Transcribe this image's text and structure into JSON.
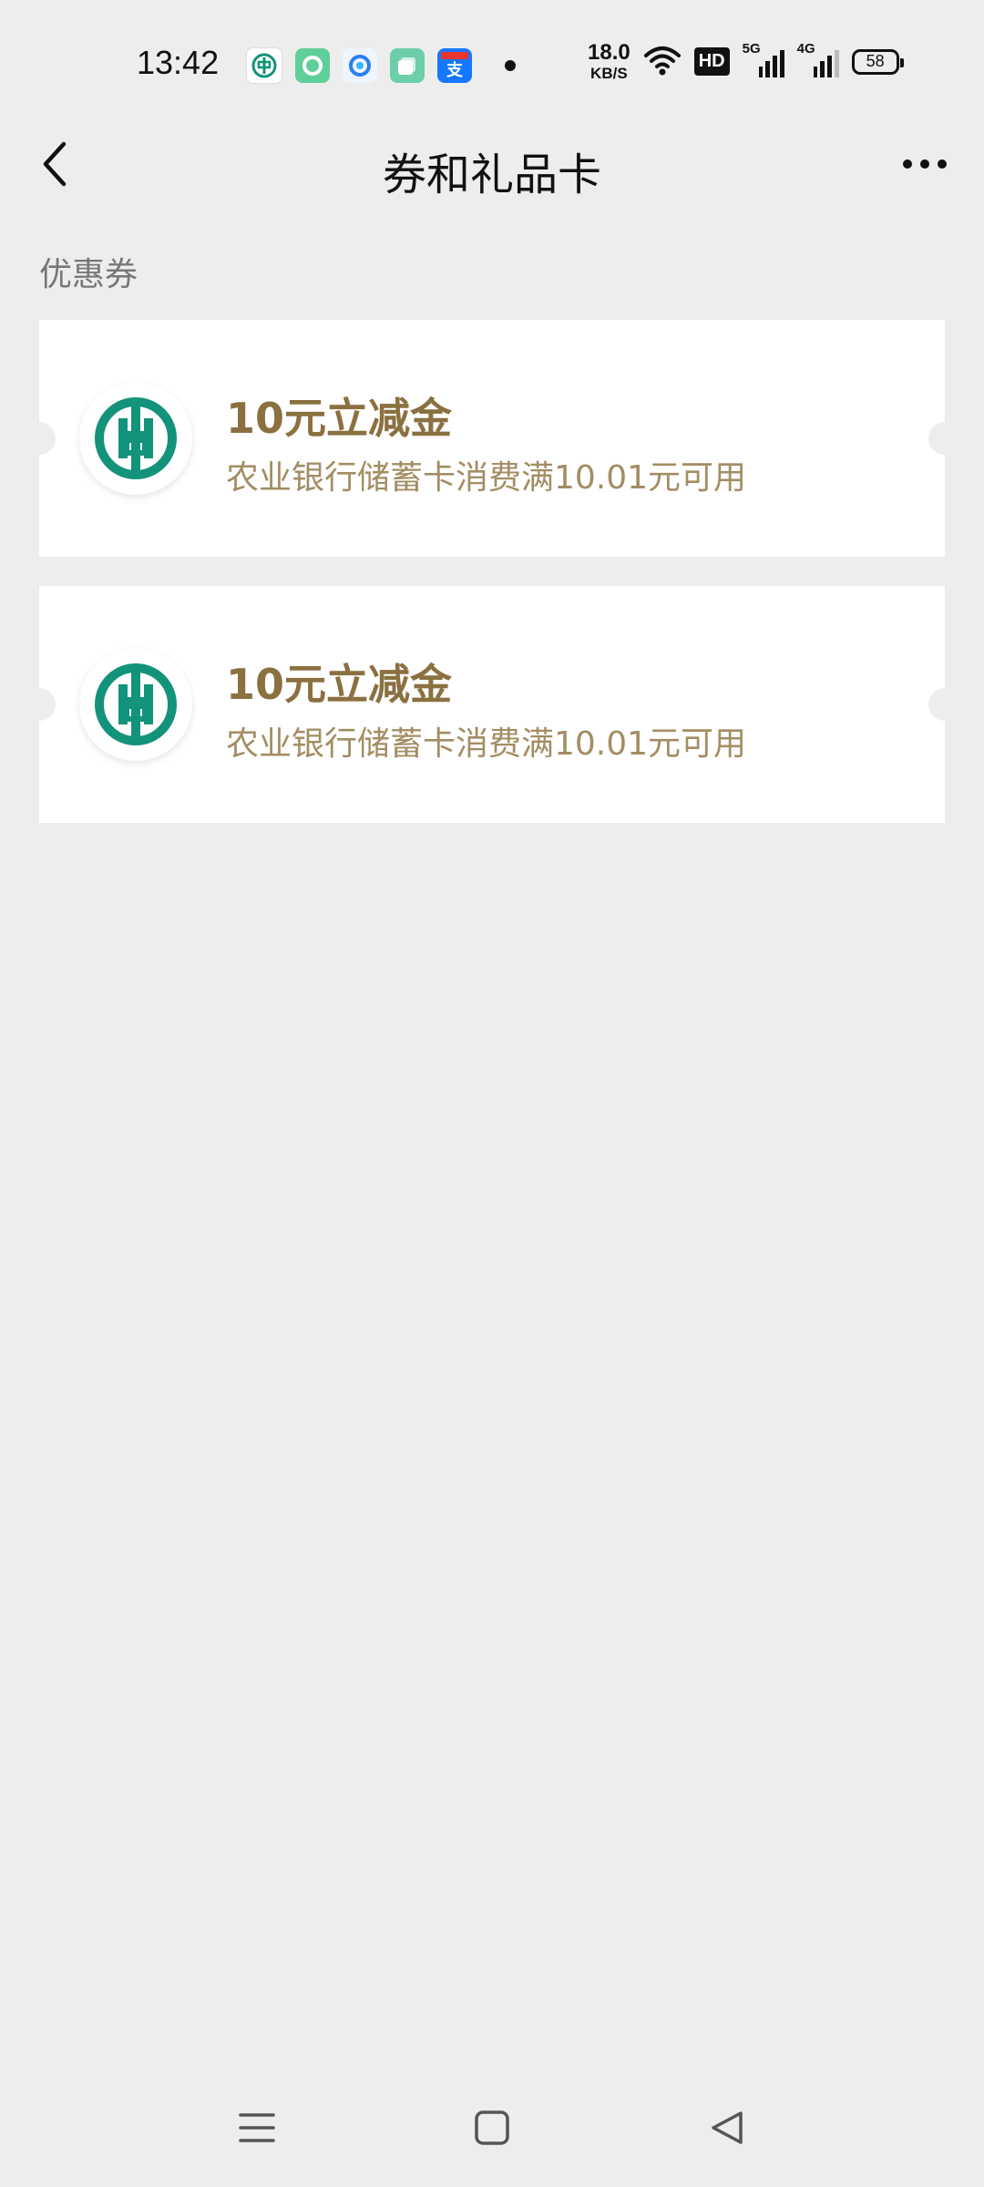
{
  "status_bar": {
    "time": "13:42",
    "net_speed_value": "18.0",
    "net_speed_unit": "KB/S",
    "hd_label": "HD",
    "signal1_label": "5G",
    "signal2_label": "4G",
    "battery": "58"
  },
  "header": {
    "title": "券和礼品卡"
  },
  "section": {
    "title": "优惠券"
  },
  "coupons": [
    {
      "title": "10元立减金",
      "description": "农业银行储蓄卡消费满10.01元可用",
      "logo": "abc-bank-logo"
    },
    {
      "title": "10元立减金",
      "description": "农业银行储蓄卡消费满10.01元可用",
      "logo": "abc-bank-logo"
    }
  ],
  "colors": {
    "background": "#ededed",
    "coupon_title": "#8b7040",
    "coupon_desc": "#a38d63",
    "bank_green": "#13937a"
  }
}
